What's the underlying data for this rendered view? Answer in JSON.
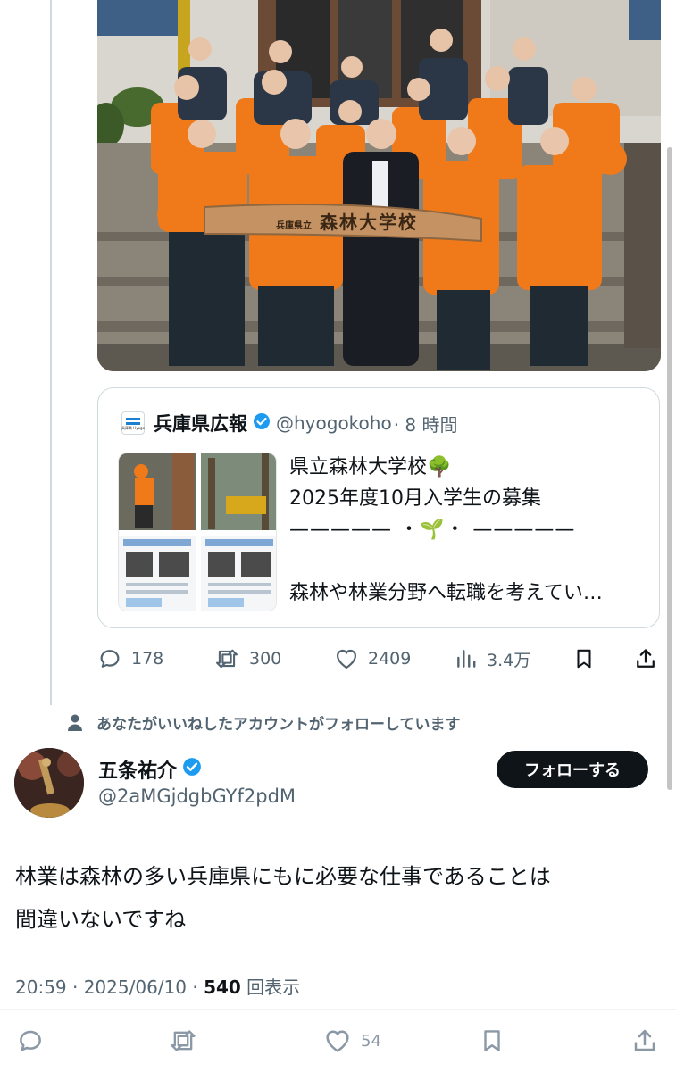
{
  "quoted": {
    "name": "兵庫県広報",
    "handle": "@hyogokoho",
    "time": "· 8 時間",
    "logo_text": "兵庫県 Hyogo",
    "lines": [
      "県立森林大学校🌳",
      "2025年度10月入学生の募集",
      "————— ・🌱・ —————",
      "森林や林業分野へ転職を考えてい…"
    ]
  },
  "photo": {
    "sign_text": "森林大学校",
    "sign_prefix": "兵庫県立"
  },
  "actions": {
    "replies": "178",
    "reposts": "300",
    "likes": "2409",
    "views": "3.4万"
  },
  "social_context": "あなたがいいねしたアカウントがフォローしています",
  "author": {
    "name": "五条祐介",
    "handle": "@2aMGjdgbGYf2pdM",
    "follow_label": "フォローする"
  },
  "post": {
    "text_line1": "林業は森林の多い兵庫県にもに必要な仕事であることは",
    "text_line2": "間違いないですね",
    "time": "20:59 · 2025/06/10 · ",
    "views_count": "540",
    "views_label": "回表示"
  },
  "bottom": {
    "likes": "54"
  },
  "colors": {
    "verified": "#1d9bf0",
    "secondary": "#536471",
    "accent_orange": "#f07a1a"
  }
}
